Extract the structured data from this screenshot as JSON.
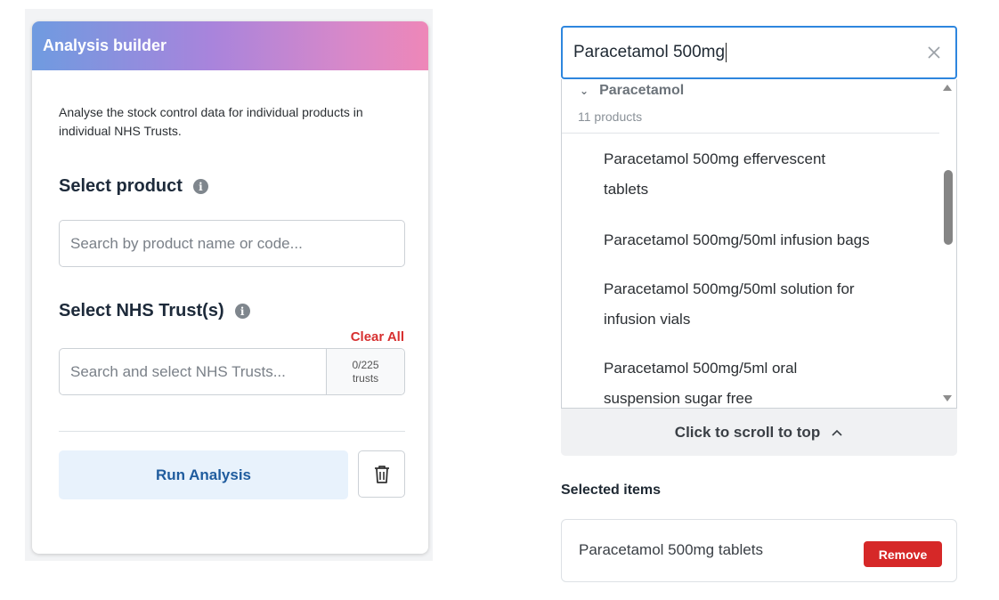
{
  "builder": {
    "title": "Analysis builder",
    "description": "Analyse the stock control data for individual products in individual NHS Trusts.",
    "product_section": {
      "title": "Select product",
      "placeholder": "Search by product name or code..."
    },
    "trust_section": {
      "title": "Select NHS Trust(s)",
      "clear_all": "Clear All",
      "placeholder": "Search and select NHS Trusts...",
      "count": "0/225",
      "count_unit": "trusts"
    },
    "run_button": "Run Analysis",
    "delete_icon": "trash-icon"
  },
  "product_search": {
    "value": "Paracetamol 500mg",
    "group": {
      "name": "Paracetamol",
      "count": "11 products"
    },
    "options": [
      {
        "line1": "Paracetamol 500mg effervescent",
        "line2": "tablets"
      },
      {
        "line1": "Paracetamol 500mg/50ml infusion bags",
        "line2": ""
      },
      {
        "line1": "Paracetamol 500mg/50ml solution for",
        "line2": "infusion vials"
      },
      {
        "line1": "Paracetamol 500mg/5ml oral",
        "line2": "suspension sugar free"
      }
    ],
    "scroll_to_top": "Click to scroll to top"
  },
  "selected": {
    "title": "Selected items",
    "items": [
      {
        "name": "Paracetamol 500mg tablets",
        "remove_label": "Remove"
      }
    ]
  },
  "colors": {
    "accent_blue": "#2e86de",
    "danger_red": "#d62828",
    "run_button_bg": "#e8f2fc"
  }
}
